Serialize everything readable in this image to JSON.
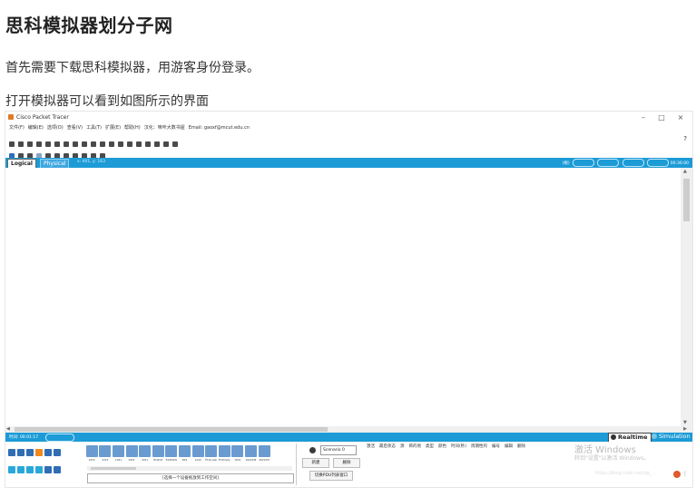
{
  "article": {
    "title": "思科模拟器划分子网",
    "paragraph1": "首先需要下载思科模拟器，用游客身份登录。",
    "paragraph2": "打开模拟器可以看到如图所示的界面"
  },
  "app": {
    "window_title": "Cisco Packet Tracer",
    "minimize": "–",
    "maximize": "□",
    "close": "×",
    "menu": [
      "文件(F)",
      "编辑(E)",
      "选项(O)",
      "查看(V)",
      "工具(T)",
      "扩展(E)",
      "帮助(H)",
      "汉化：咪咔大数书屋",
      "Email: gaoxf@mcut.edu.cn"
    ],
    "help_label": "?",
    "tabs": {
      "logical": "Logical",
      "physical": "Physical",
      "coords": "x: 401, y: 163"
    },
    "tab_right_label": "(根)",
    "time_label": "时间: 00:01:17",
    "clock_label": "00:36:00",
    "realtime_label": "Realtime",
    "simulation_label": "Simulation",
    "device_labels": [
      "4331",
      "4321",
      "1941",
      "2901",
      "2911",
      "819IOX",
      "819HGW",
      "829",
      "1240",
      "PT-Router",
      "PT-Empty",
      "1841",
      "2620XM",
      "2621XM"
    ],
    "device_hint": "[选择一个设备拖放到工作空间]",
    "scenario": "Scenario 0",
    "pdu_new": "新建",
    "pdu_delete": "删除",
    "pdu_toggle": "切换PDU列表窗口",
    "pdu_headers": [
      "激活",
      "最后状态",
      "源",
      "目的地",
      "类型",
      "颜色",
      "时间(秒)",
      "周期性的",
      "编号",
      "编辑",
      "删除"
    ],
    "watermark_line1": "激活 Windows",
    "watermark_line2": "转到\"设置\"以激活 Windows。",
    "watermark_line3": "https://blog.csdn.net/qq_..."
  },
  "colors": {
    "accent_blue": "#1c9bd6"
  }
}
